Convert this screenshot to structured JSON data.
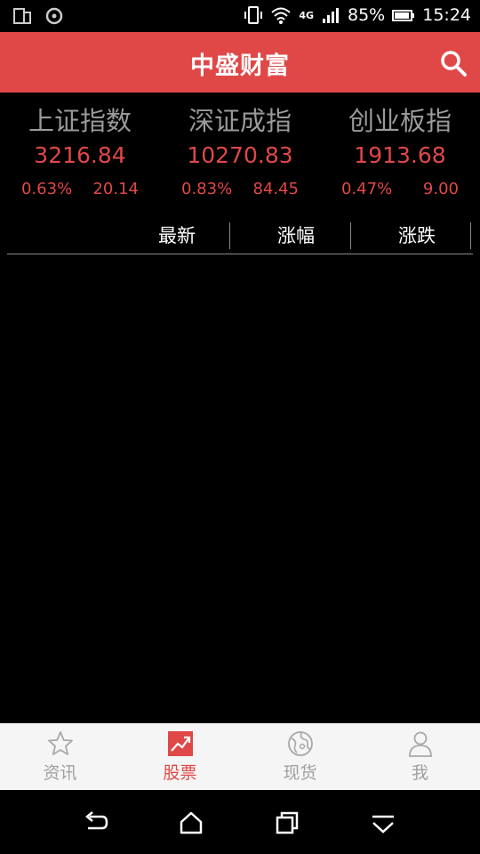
{
  "status_bar": {
    "battery": "85%",
    "time": "15:24",
    "network": "4G"
  },
  "header": {
    "title": "中盛财富"
  },
  "indices": [
    {
      "name": "上证指数",
      "value": "3216.84",
      "pct": "0.63%",
      "diff": "20.14"
    },
    {
      "name": "深证成指",
      "value": "10270.83",
      "pct": "0.83%",
      "diff": "84.45"
    },
    {
      "name": "创业板指",
      "value": "1913.68",
      "pct": "0.47%",
      "diff": "9.00"
    }
  ],
  "table": {
    "columns": [
      "最新",
      "涨幅",
      "涨跌"
    ]
  },
  "tabs": [
    {
      "label": "资讯",
      "icon": "star-icon"
    },
    {
      "label": "股票",
      "icon": "stock-chart-icon"
    },
    {
      "label": "现货",
      "icon": "globe-icon"
    },
    {
      "label": "我",
      "icon": "person-icon"
    }
  ],
  "colors": {
    "accent": "#e04848",
    "index_name": "#9a9a9a",
    "tab_inactive": "#a0a0a0",
    "tabbar_bg": "#f5f5f5"
  }
}
